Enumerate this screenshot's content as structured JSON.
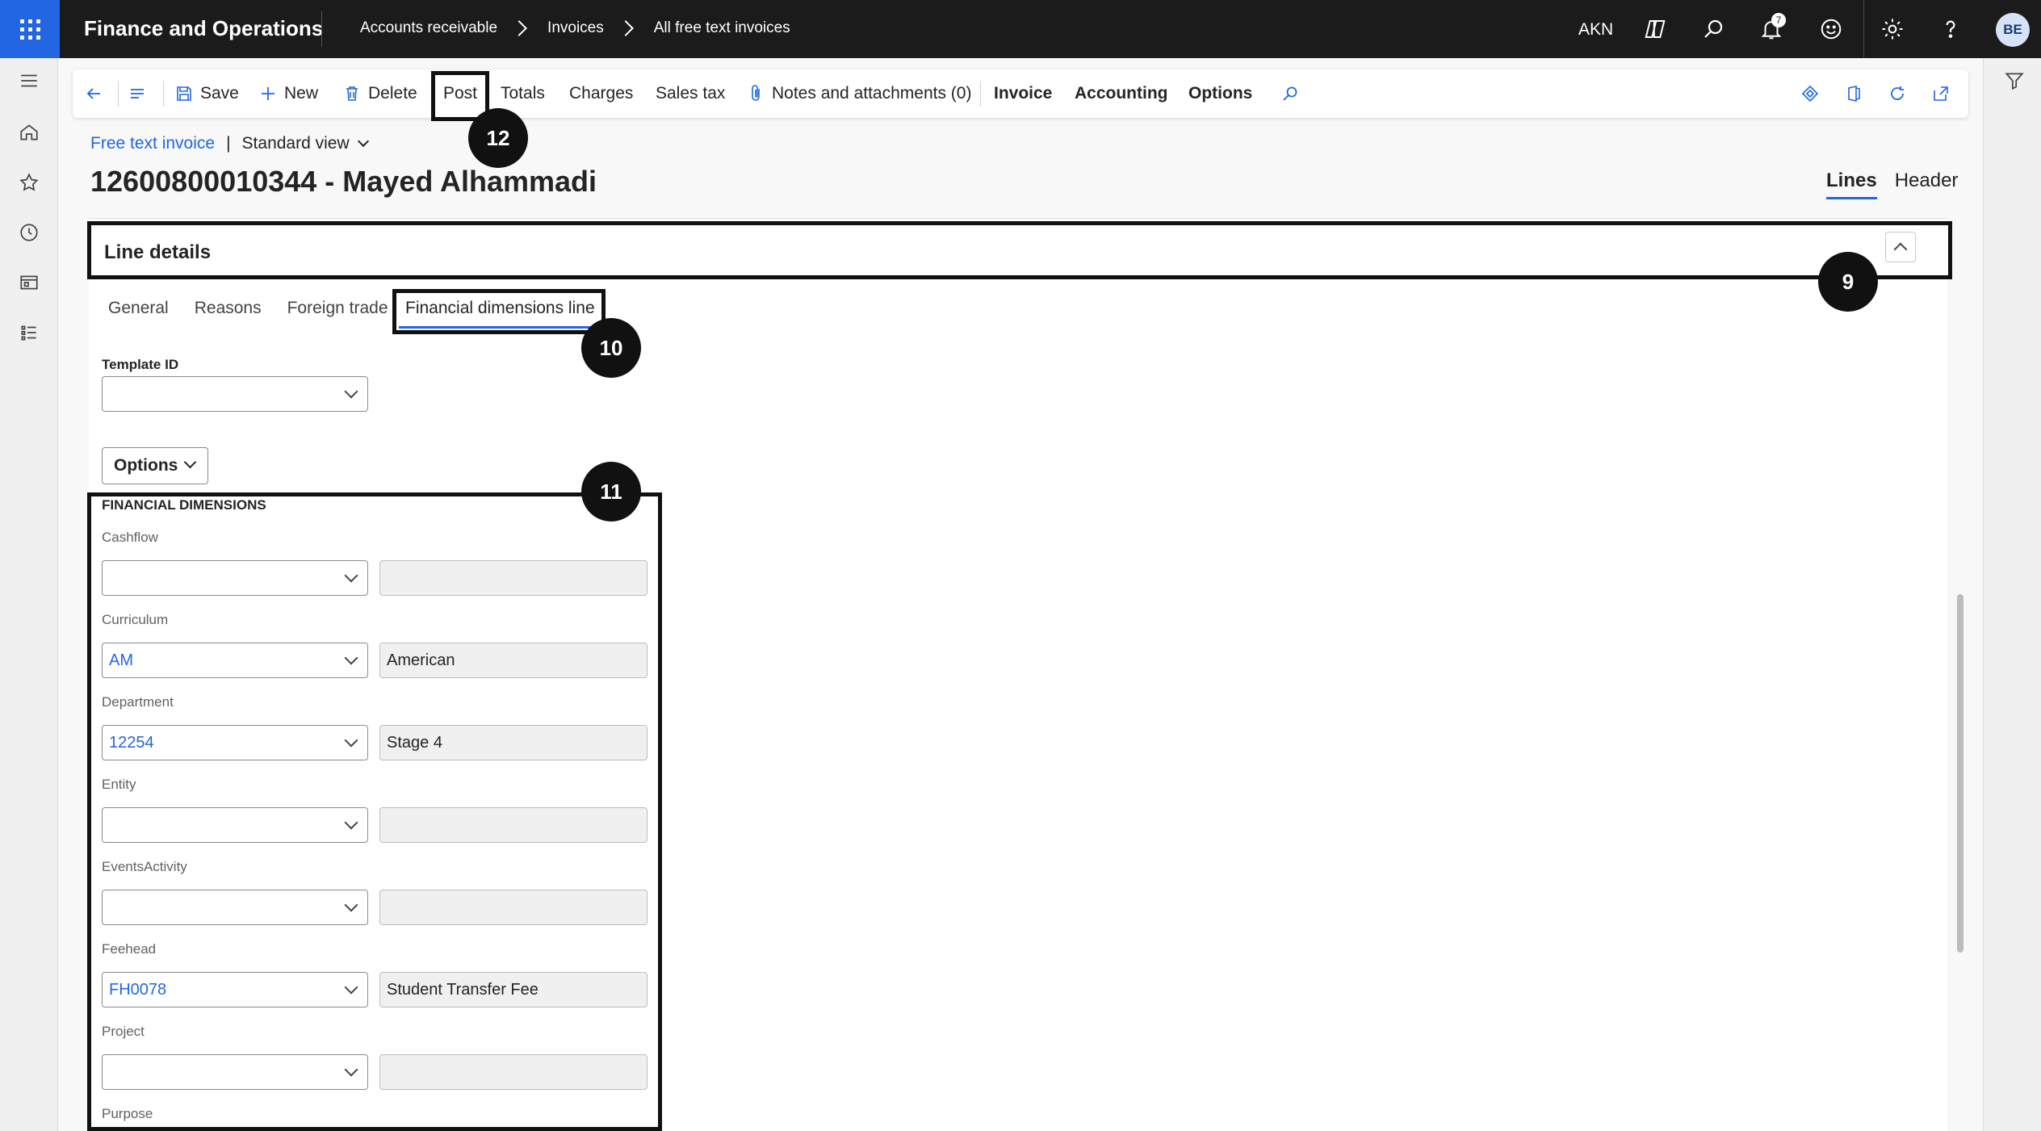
{
  "topbar": {
    "app_title": "Finance and Operations",
    "breadcrumb": [
      "Accounts receivable",
      "Invoices",
      "All free text invoices"
    ],
    "company": "AKN",
    "notification_count": "7",
    "avatar_initials": "BE"
  },
  "actionpane": {
    "save": "Save",
    "new": "New",
    "delete": "Delete",
    "post": "Post",
    "totals": "Totals",
    "charges": "Charges",
    "sales_tax": "Sales tax",
    "notes": "Notes and attachments (0)",
    "invoice": "Invoice",
    "accounting": "Accounting",
    "options": "Options"
  },
  "header": {
    "form_link": "Free text invoice",
    "separator": "|",
    "view_name": "Standard view",
    "record_title": "12600800010344 - Mayed Alhammadi",
    "tabs": {
      "lines": "Lines",
      "header": "Header"
    }
  },
  "line_details": {
    "title": "Line details",
    "subtabs": [
      "General",
      "Reasons",
      "Foreign trade",
      "Financial dimensions line"
    ],
    "template_id_label": "Template ID",
    "template_id_value": "",
    "options_label": "Options",
    "section_heading": "FINANCIAL DIMENSIONS",
    "dimensions": [
      {
        "label": "Cashflow",
        "value": "",
        "description": ""
      },
      {
        "label": "Curriculum",
        "value": "AM",
        "description": "American"
      },
      {
        "label": "Department",
        "value": "12254",
        "description": "Stage 4"
      },
      {
        "label": "Entity",
        "value": "",
        "description": ""
      },
      {
        "label": "EventsActivity",
        "value": "",
        "description": ""
      },
      {
        "label": "Feehead",
        "value": "FH0078",
        "description": "Student Transfer Fee"
      },
      {
        "label": "Project",
        "value": "",
        "description": ""
      },
      {
        "label": "Purpose",
        "value": "",
        "description": ""
      }
    ]
  },
  "callouts": {
    "c9": "9",
    "c10": "10",
    "c11": "11",
    "c12": "12"
  }
}
